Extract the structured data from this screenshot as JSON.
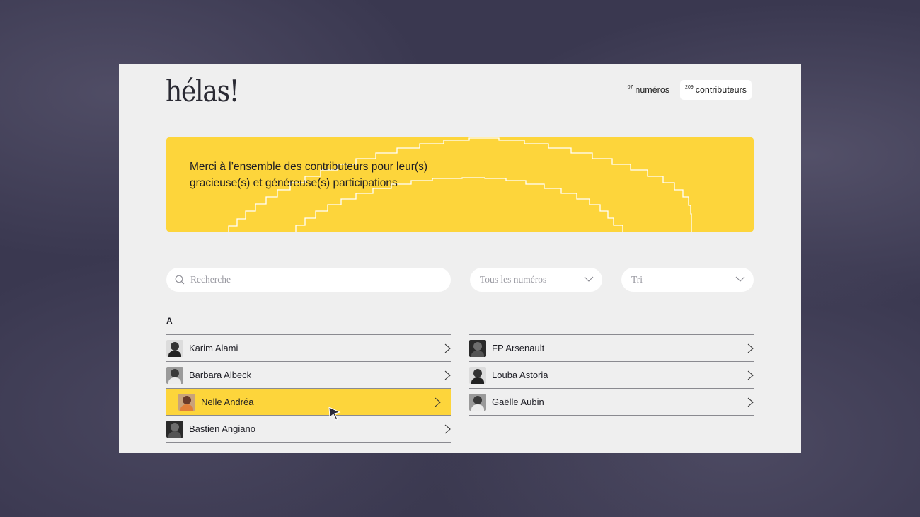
{
  "site": {
    "logo": "hélas!"
  },
  "nav": [
    {
      "count": "07",
      "label": "numéros",
      "active": false
    },
    {
      "count": "209",
      "label": "contributeurs",
      "active": true
    }
  ],
  "banner": {
    "text_line1": "Merci à l’ensemble des contributeurs pour leur(s)",
    "text_line2": "gracieuse(s) et généreuse(s) participations",
    "color": "#fdd53b"
  },
  "filters": {
    "search_placeholder": "Recherche",
    "issue_select": "Tous les numéros",
    "sort_select": "Tri"
  },
  "list": {
    "letter": "A",
    "left": [
      {
        "name": "Karim Alami",
        "avatar": "portrait-bw"
      },
      {
        "name": "Barbara Albeck",
        "avatar": "portrait-bw"
      },
      {
        "name": "Nelle Andréa",
        "avatar": "portrait-color",
        "highlighted": true
      },
      {
        "name": "Bastien Angiano",
        "avatar": "portrait-bw"
      }
    ],
    "right": [
      {
        "name": "FP Arsenault",
        "avatar": "portrait-bw"
      },
      {
        "name": "Louba Astoria",
        "avatar": "portrait-bw"
      },
      {
        "name": "Gaëlle Aubin",
        "avatar": "portrait-bw"
      }
    ]
  },
  "colors": {
    "accent": "#fdd53b",
    "panel": "#efefef",
    "backdrop": "#3a3850"
  }
}
